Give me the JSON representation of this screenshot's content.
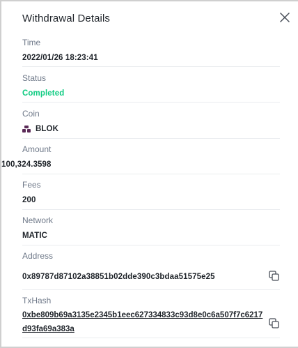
{
  "title": "Withdrawal Details",
  "fields": {
    "time": {
      "label": "Time",
      "value": "2022/01/26 18:23:41"
    },
    "status": {
      "label": "Status",
      "value": "Completed"
    },
    "coin": {
      "label": "Coin",
      "value": "BLOK"
    },
    "amount": {
      "label": "Amount",
      "value": "100,324.3598"
    },
    "fees": {
      "label": "Fees",
      "value": "200"
    },
    "network": {
      "label": "Network",
      "value": "MATIC"
    },
    "address": {
      "label": "Address",
      "value": "0x89787d87102a38851b02dde390c3bdaa51575e25"
    },
    "txhash": {
      "label": "TxHash",
      "value": "0xbe809b69a3135e2345b1eec627334833c93d8e0c6a507f7c6217d93fa69a383a"
    }
  },
  "colors": {
    "status_completed": "#0ecb81",
    "label": "#707a8a",
    "text": "#1e2329",
    "coin_icon": "#5b2a57"
  },
  "icons": {
    "close": "close-icon",
    "coin": "blok-coin-icon",
    "copy": "copy-icon"
  }
}
